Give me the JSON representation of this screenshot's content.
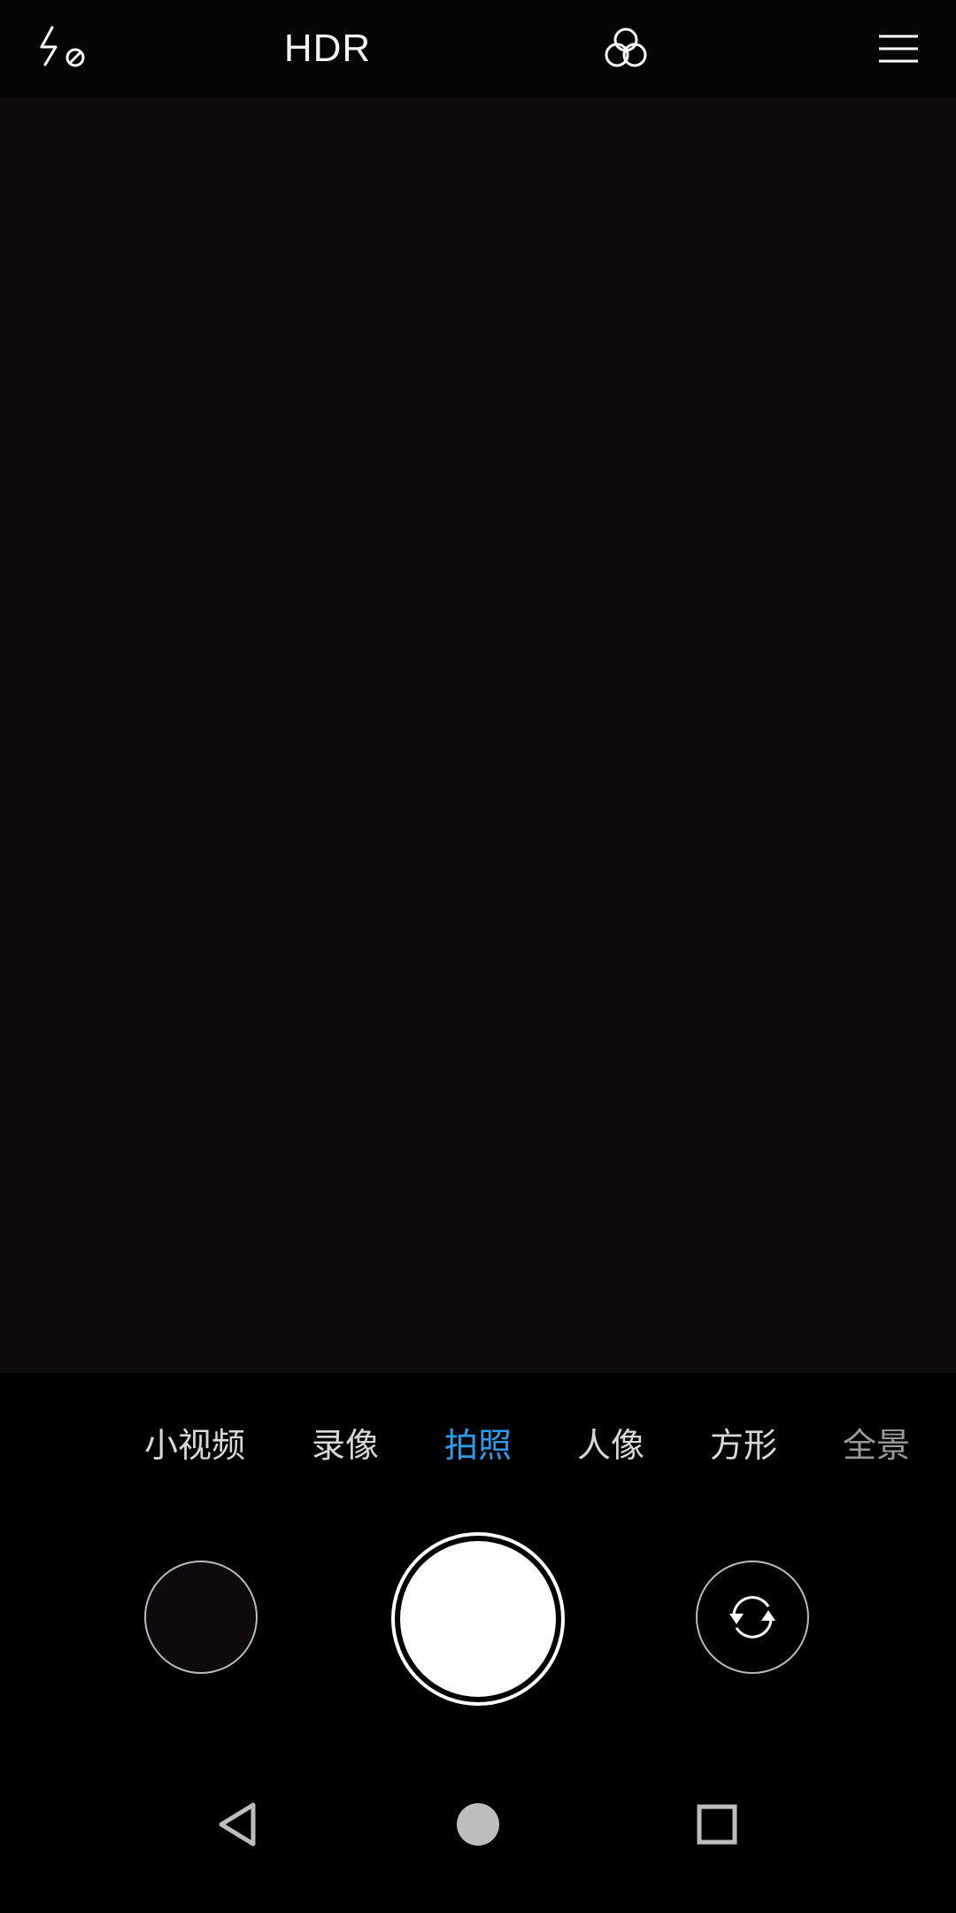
{
  "topbar": {
    "flash_icon": "flash-off-icon",
    "hdr_label": "HDR",
    "filter_icon": "filter-circles-icon",
    "menu_icon": "menu-icon"
  },
  "modes": {
    "items": [
      {
        "label": "小视频"
      },
      {
        "label": "录像"
      },
      {
        "label": "拍照"
      },
      {
        "label": "人像"
      },
      {
        "label": "方形"
      },
      {
        "label": "全景"
      }
    ],
    "selected": "拍照"
  },
  "controls": {
    "gallery_icon": "gallery-thumbnail",
    "shutter_icon": "shutter-icon",
    "switch_icon": "switch-camera-icon"
  },
  "navbar": {
    "back_icon": "back-triangle-icon",
    "home_icon": "home-circle-icon",
    "recents_icon": "recents-square-icon"
  },
  "colors": {
    "accent": "#2a9dea",
    "viewfinder": "#0e0a0e",
    "background": "#000000"
  }
}
